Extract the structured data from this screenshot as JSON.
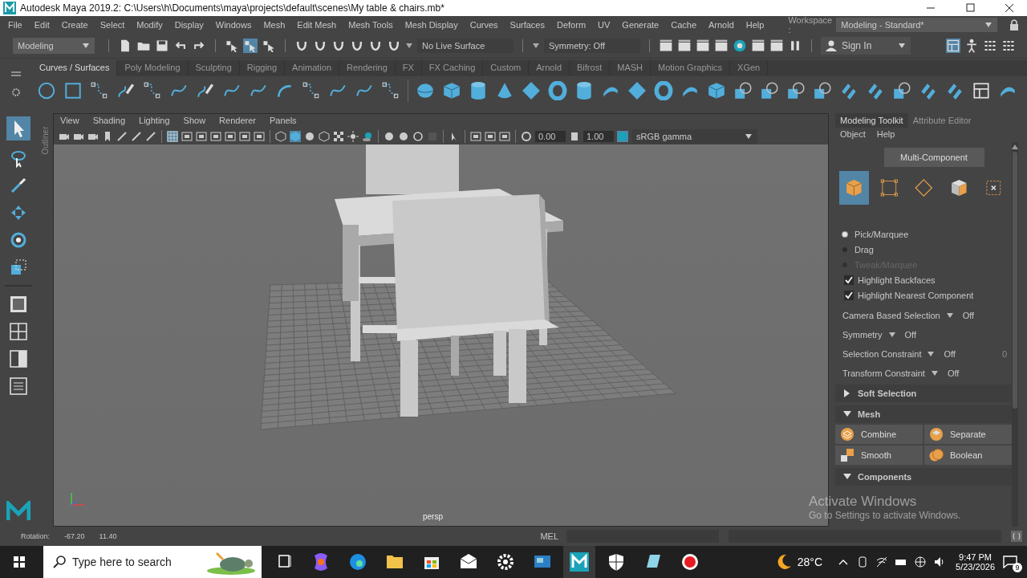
{
  "window": {
    "title": "Autodesk Maya 2019.2: C:\\Users\\h\\Documents\\maya\\projects\\default\\scenes\\My table & chairs.mb*"
  },
  "menu_bar": {
    "items": [
      "File",
      "Edit",
      "Create",
      "Select",
      "Modify",
      "Display",
      "Windows",
      "Mesh",
      "Edit Mesh",
      "Mesh Tools",
      "Mesh Display",
      "Curves",
      "Surfaces",
      "Deform",
      "UV",
      "Generate",
      "Cache",
      "Arnold",
      "Help"
    ],
    "workspace_label": "Workspace :",
    "workspace": "Modeling - Standard*"
  },
  "status_line": {
    "menu_set": "Modeling",
    "live_surface": "No Live Surface",
    "symmetry": "Symmetry: Off",
    "sign_in": "Sign In"
  },
  "shelf": {
    "tabs": [
      {
        "label": "Curves / Surfaces",
        "selected": true
      },
      {
        "label": "Poly Modeling",
        "selected": false
      },
      {
        "label": "Sculpting",
        "selected": false
      },
      {
        "label": "Rigging",
        "selected": false
      },
      {
        "label": "Animation",
        "selected": false
      },
      {
        "label": "Rendering",
        "selected": false
      },
      {
        "label": "FX",
        "selected": false
      },
      {
        "label": "FX Caching",
        "selected": false
      },
      {
        "label": "Custom",
        "selected": false
      },
      {
        "label": "Arnold",
        "selected": false
      },
      {
        "label": "Bifrost",
        "selected": false
      },
      {
        "label": "MASH",
        "selected": false
      },
      {
        "label": "Motion Graphics",
        "selected": false
      },
      {
        "label": "XGen",
        "selected": false
      }
    ]
  },
  "outliner_tab": "Outliner",
  "viewport": {
    "menus": [
      "View",
      "Shading",
      "Lighting",
      "Show",
      "Renderer",
      "Panels"
    ],
    "exposure": "0.00",
    "gamma": "1.00",
    "color_space": "sRGB gamma",
    "camera": "persp"
  },
  "toolkit": {
    "tabs": [
      {
        "label": "Modeling Toolkit",
        "selected": true
      },
      {
        "label": "Attribute Editor",
        "selected": false
      }
    ],
    "menus": [
      "Object",
      "Help"
    ],
    "mode": "Multi-Component",
    "components": [
      {
        "kind": "object",
        "selected": true
      },
      {
        "kind": "vertex",
        "selected": false
      },
      {
        "kind": "edge",
        "selected": false
      },
      {
        "kind": "face",
        "selected": false
      },
      {
        "kind": "uv",
        "selected": false
      }
    ],
    "selection_modes": [
      {
        "label": "Pick/Marquee",
        "selected": true,
        "disabled": false
      },
      {
        "label": "Drag",
        "selected": false,
        "disabled": false
      },
      {
        "label": "Tweak/Marquee",
        "selected": false,
        "disabled": true
      }
    ],
    "options": [
      {
        "label": "Highlight Backfaces",
        "checked": true
      },
      {
        "label": "Highlight Nearest Component",
        "checked": true
      }
    ],
    "settings": [
      {
        "label": "Camera Based Selection",
        "value": "Off"
      },
      {
        "label": "Symmetry",
        "value": "Off"
      },
      {
        "label": "Selection Constraint",
        "value": "Off",
        "extra": "0"
      },
      {
        "label": "Transform Constraint",
        "value": "Off"
      }
    ],
    "sections": [
      {
        "title": "Soft Selection",
        "expanded": false
      },
      {
        "title": "Mesh",
        "expanded": true,
        "buttons": [
          {
            "label": "Combine",
            "kind": "combine"
          },
          {
            "label": "Separate",
            "kind": "separate"
          },
          {
            "label": "Smooth",
            "kind": "smooth"
          },
          {
            "label": "Boolean",
            "kind": "boolean"
          }
        ]
      },
      {
        "title": "Components",
        "expanded": true
      }
    ]
  },
  "command_line": {
    "feedback_label": "Rotation:",
    "values": [
      "-67.20",
      "11.40"
    ],
    "language": "MEL"
  },
  "activation_notice": {
    "title": "Activate Windows",
    "message": "Go to Settings to activate Windows."
  },
  "taskbar": {
    "search_placeholder": "Type here to search",
    "temperature": "28°C",
    "time": "9:47 PM",
    "date": "5/23/2026",
    "notifications": "9"
  }
}
